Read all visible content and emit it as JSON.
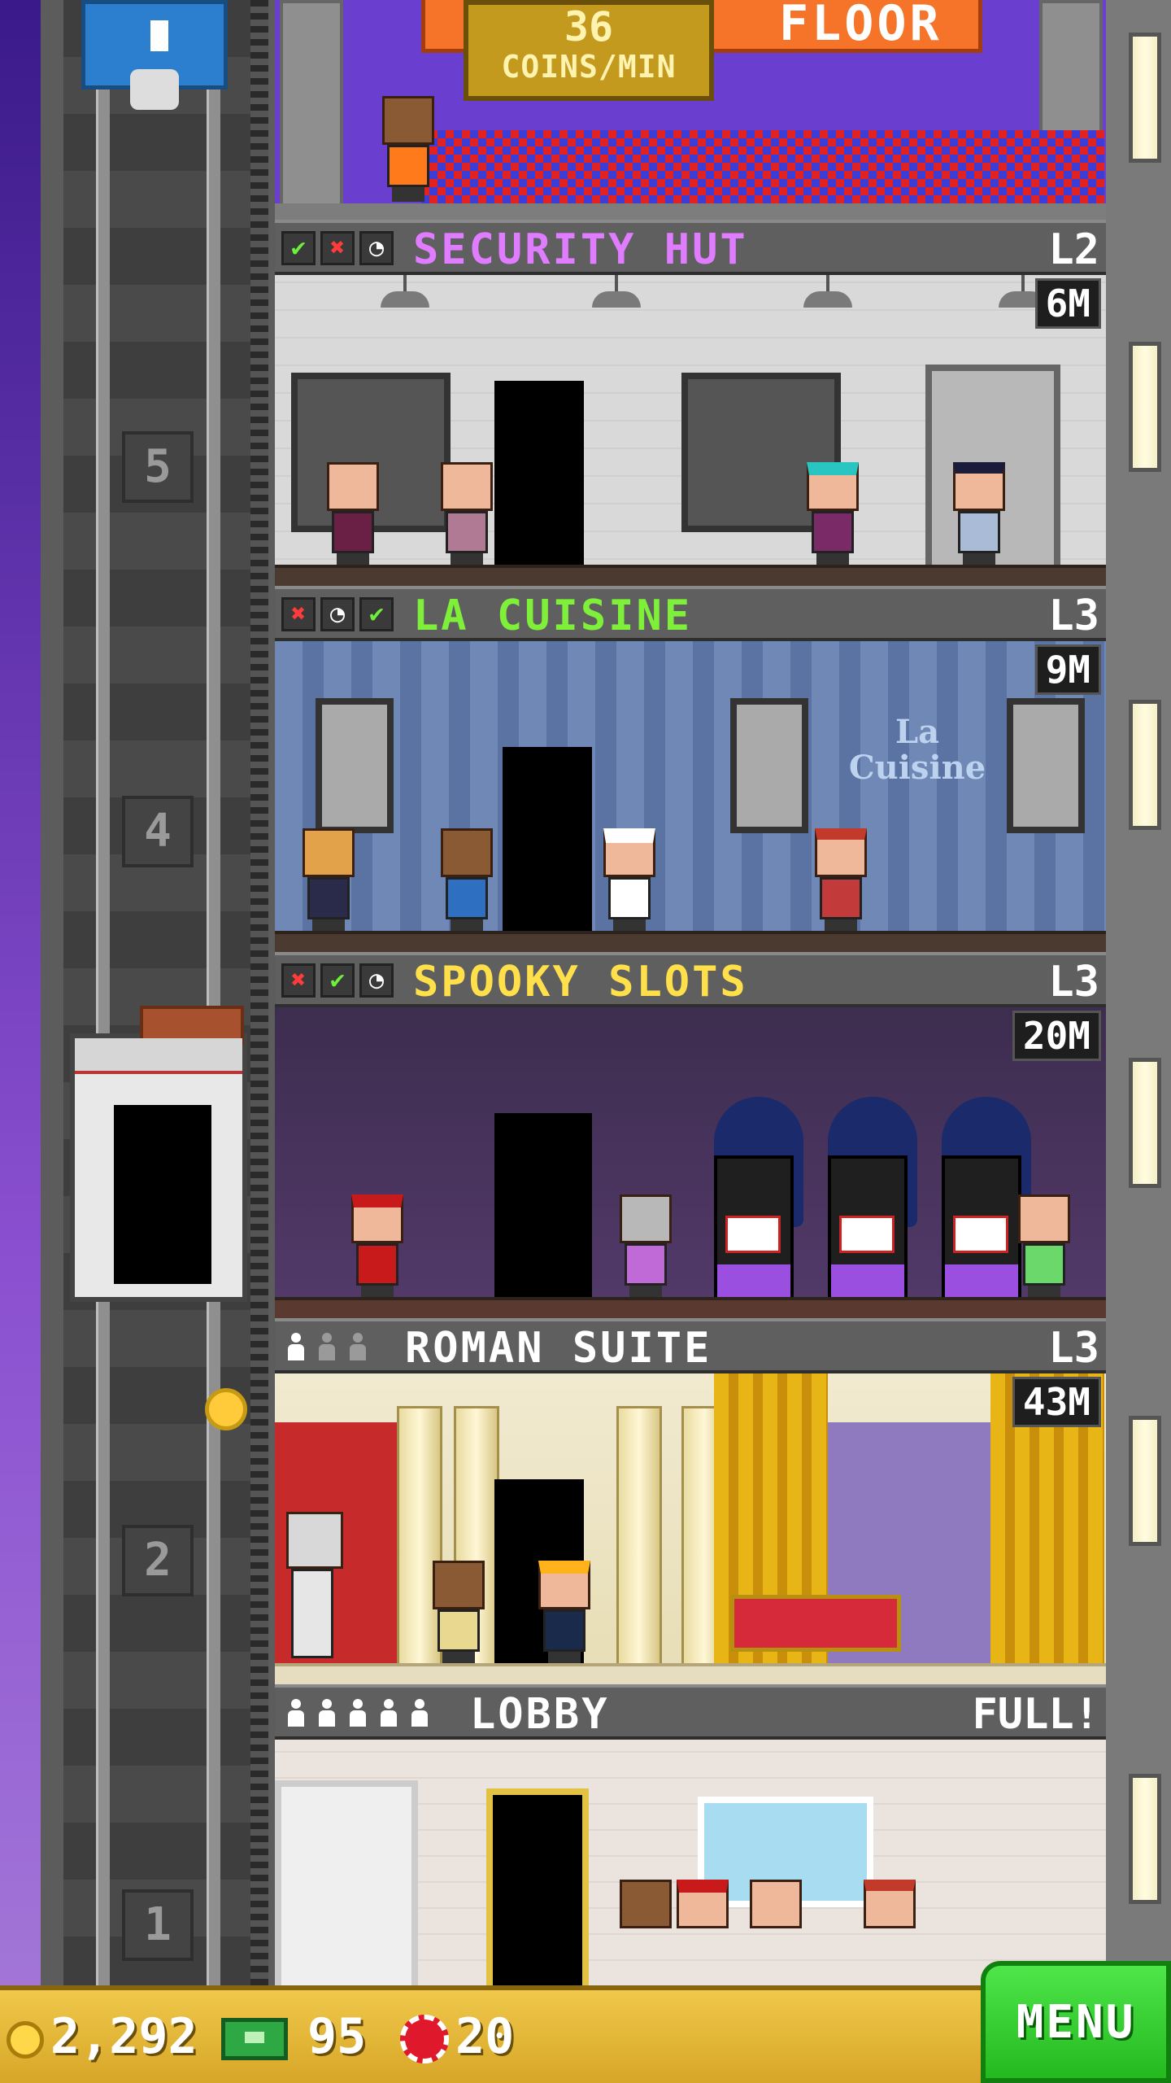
{
  "top_room": {
    "sign_text": "FLOOR",
    "coins_value": "36",
    "coins_unit": "COINS/MIN"
  },
  "floors": [
    {
      "name": "SECURITY HUT",
      "level": "L2",
      "timer": "6M",
      "name_color": "#e07cff",
      "status": [
        "check",
        "cross",
        "clock"
      ]
    },
    {
      "name": "LA CUISINE",
      "level": "L3",
      "timer": "9M",
      "name_color": "#7ef03a",
      "status": [
        "cross",
        "clock",
        "check"
      ],
      "wall_sign": "La Cuisine"
    },
    {
      "name": "SPOOKY SLOTS",
      "level": "L3",
      "timer": "20M",
      "name_color": "#ffe04a",
      "status": [
        "cross",
        "check",
        "clock"
      ]
    },
    {
      "name": "ROMAN SUITE",
      "level": "L3",
      "timer": "43M",
      "name_color": "#ffffff",
      "residents": [
        true,
        false,
        false
      ]
    },
    {
      "name": "LOBBY",
      "level": "FULL!",
      "name_color": "#ffffff",
      "residents": [
        true,
        true,
        true,
        true,
        true
      ]
    }
  ],
  "shaft": {
    "floor_numbers": [
      "5",
      "4",
      "2",
      "1"
    ]
  },
  "hud": {
    "coins": "2,292",
    "bux": "95",
    "chips": "20",
    "menu_label": "MENU"
  },
  "colors": {
    "hud_gold": "#f0c84a",
    "menu_green": "#23b91f",
    "check_green": "#6cf03b",
    "cross_red": "#ff3b3b"
  },
  "icons": {
    "status_check": "check-icon",
    "status_cross": "cross-icon",
    "status_clock": "clock-icon",
    "resident": "person-icon",
    "coin": "coin-icon",
    "bux": "cash-icon",
    "chip": "chip-icon"
  }
}
